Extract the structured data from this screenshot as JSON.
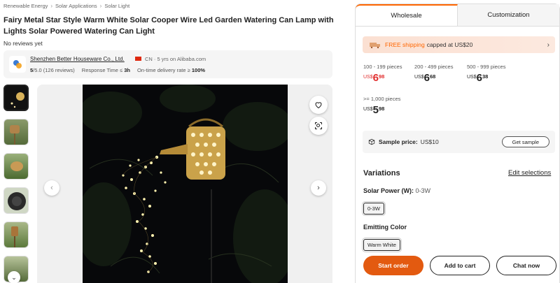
{
  "breadcrumb": [
    "Renewable Energy",
    "Solar Applications",
    "Solar Light"
  ],
  "product": {
    "title": "Fairy Metal Star Style Warm White Solar Cooper Wire Led Garden Watering Can Lamp with Lights Solar Powered Watering Can Light",
    "reviews": "No reviews yet"
  },
  "supplier": {
    "name": "Shenzhen Better Houseware Co., Ltd.",
    "meta": "CN · 5 yrs on Alibaba.com",
    "rating": "5",
    "rating_rest": "/5.0 (126 reviews)",
    "response_label": "Response Time ≤",
    "response_val": "3h",
    "delivery_label": "On-time delivery rate ≥",
    "delivery_val": "100%"
  },
  "tabs": {
    "wholesale": "Wholesale",
    "customization": "Customization"
  },
  "shipping": {
    "free": "FREE shipping",
    "rest": "capped at US$20"
  },
  "tiers": [
    {
      "range": "100 - 199 pieces",
      "currency": "US$",
      "whole": "6",
      "decimal": "98"
    },
    {
      "range": "200 - 499 pieces",
      "currency": "US$",
      "whole": "6",
      "decimal": "68"
    },
    {
      "range": "500 - 999 pieces",
      "currency": "US$",
      "whole": "6",
      "decimal": "38"
    },
    {
      "range": ">= 1,000 pieces",
      "currency": "US$",
      "whole": "5",
      "decimal": "98"
    }
  ],
  "sample": {
    "label": "Sample price:",
    "value": "US$10",
    "button": "Get sample"
  },
  "variations": {
    "title": "Variations",
    "edit": "Edit selections",
    "power_label": "Solar Power (W):",
    "power_value": "0-3W",
    "power_option": "0-3W",
    "color_label": "Emitting Color",
    "color_option": "Warm White"
  },
  "actions": {
    "start": "Start order",
    "cart": "Add to cart",
    "chat": "Chat now"
  },
  "colors": {
    "accent": "#ff6600",
    "primary_button": "#e35a10",
    "price_red": "#e12d2d"
  }
}
